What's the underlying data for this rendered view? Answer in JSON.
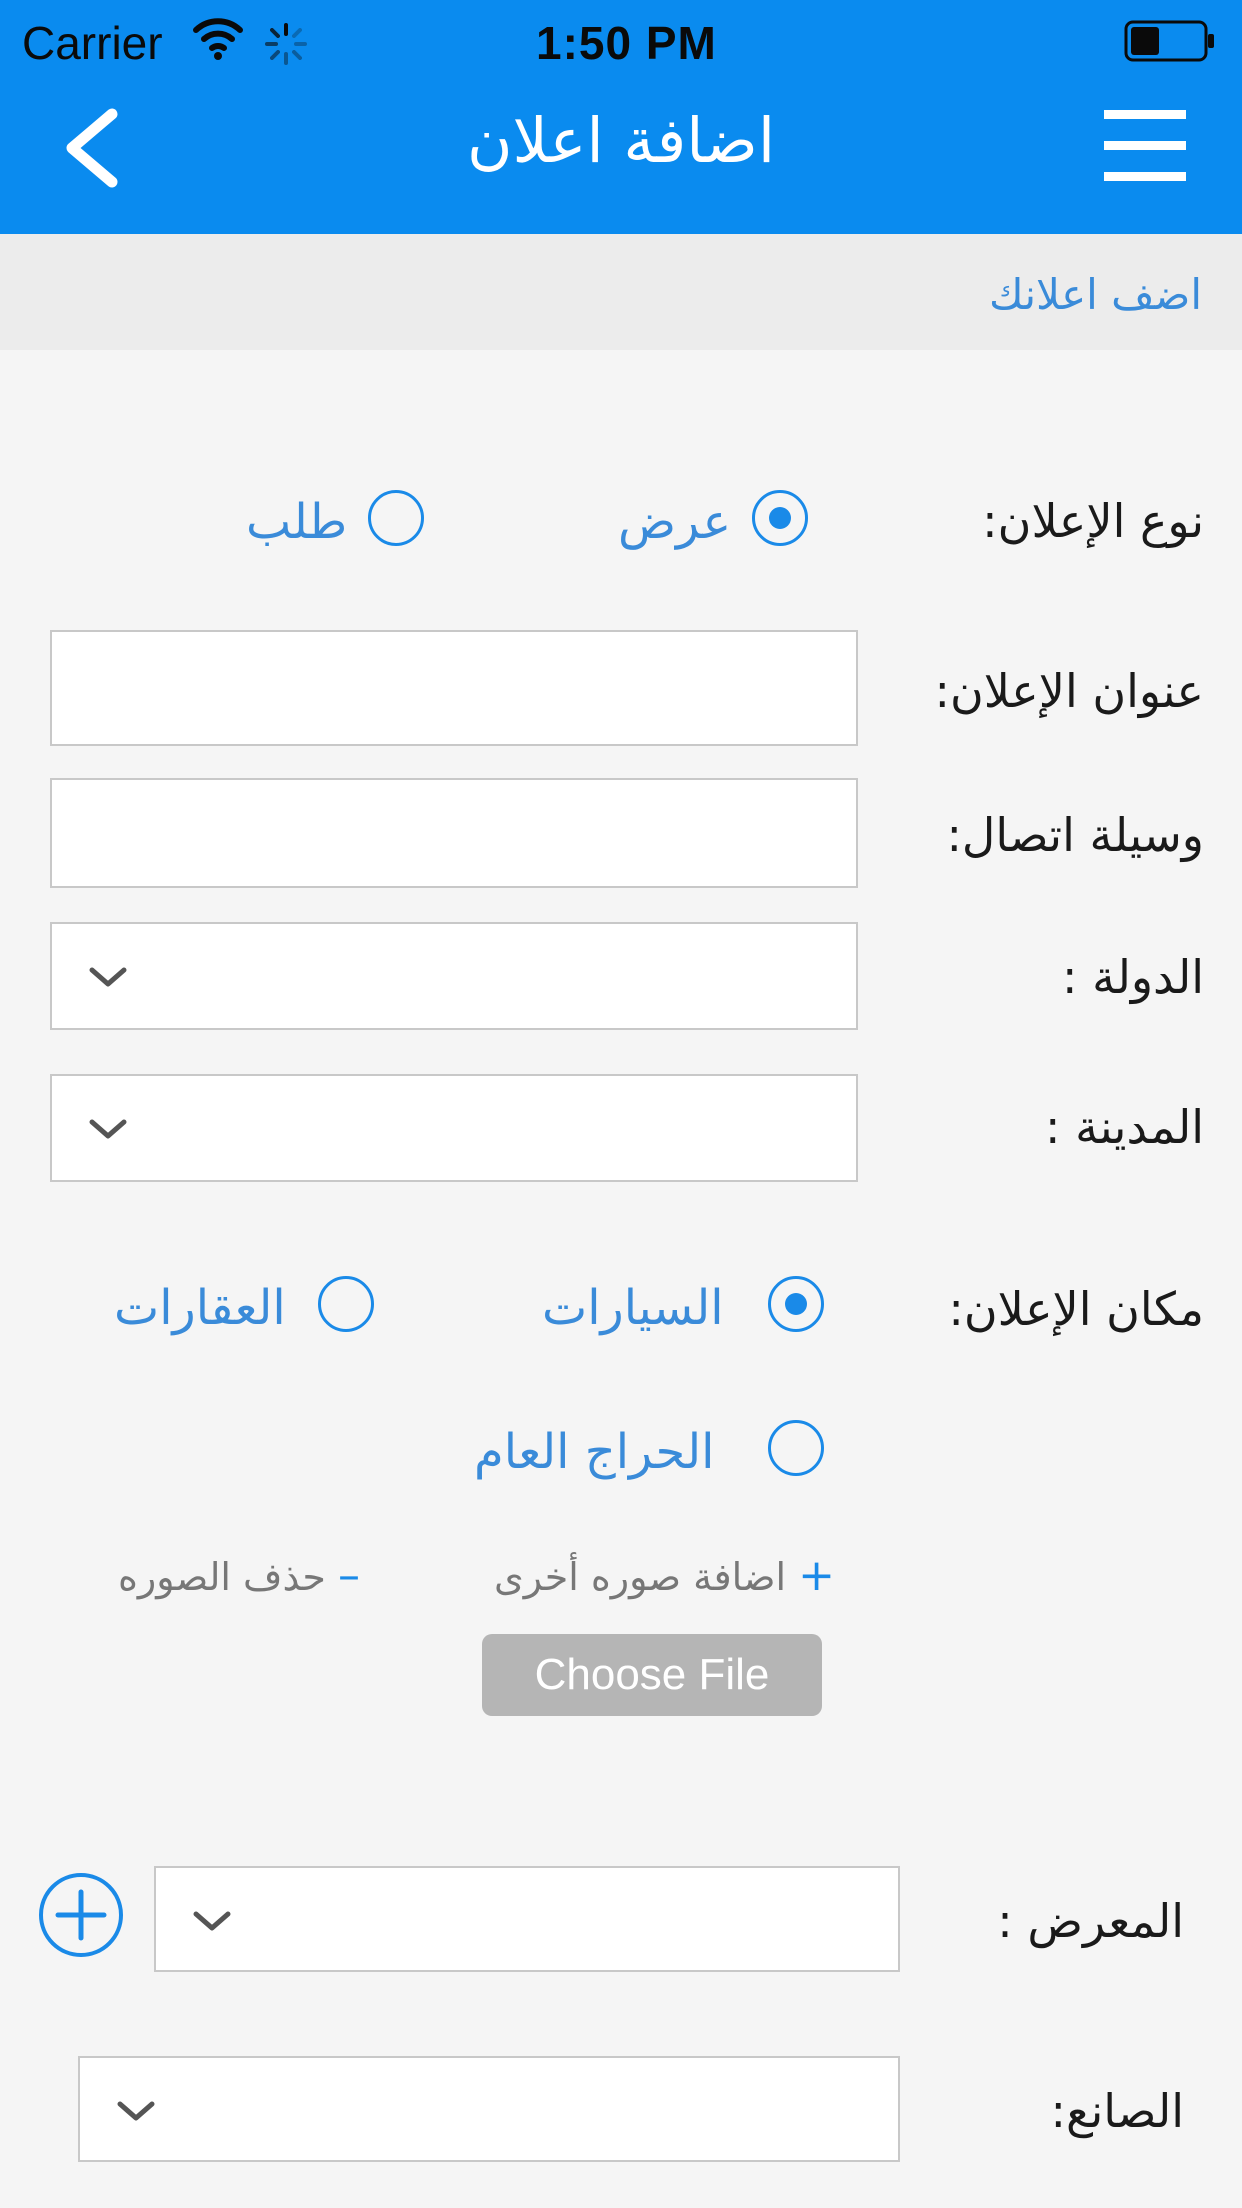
{
  "status_bar": {
    "carrier": "Carrier",
    "time": "1:50 PM"
  },
  "header": {
    "title": "اضافة اعلان",
    "back_icon": "chevron-left-icon",
    "menu_icon": "hamburger-menu-icon",
    "bg_color": "#0a8bef"
  },
  "subheader": {
    "text": "اضف اعلانك"
  },
  "form": {
    "ad_type": {
      "label": "نوع الإعلان:",
      "options": [
        {
          "label": "عرض",
          "checked": true
        },
        {
          "label": "طلب",
          "checked": false
        }
      ]
    },
    "ad_title": {
      "label": "عنوان الإعلان:",
      "value": "",
      "placeholder": ""
    },
    "contact": {
      "label": "وسيلة اتصال:",
      "value": "",
      "placeholder": ""
    },
    "country": {
      "label": "الدولة :",
      "selected": ""
    },
    "city": {
      "label": "المدينة :",
      "selected": ""
    },
    "ad_place": {
      "label": "مكان الإعلان:",
      "options": [
        {
          "label": "السيارات",
          "checked": true
        },
        {
          "label": "العقارات",
          "checked": false
        },
        {
          "label": "الحراج العام",
          "checked": false
        }
      ]
    },
    "images": {
      "add_label": "اضافة صوره أخرى",
      "remove_label": "حذف الصوره",
      "choose_file": "Choose File"
    },
    "showroom": {
      "label": "المعرض :",
      "selected": ""
    },
    "manufacturer": {
      "label": "الصانع:",
      "selected": ""
    }
  },
  "colors": {
    "accent": "#1a8ae8",
    "link_text": "#3a8bd9"
  }
}
